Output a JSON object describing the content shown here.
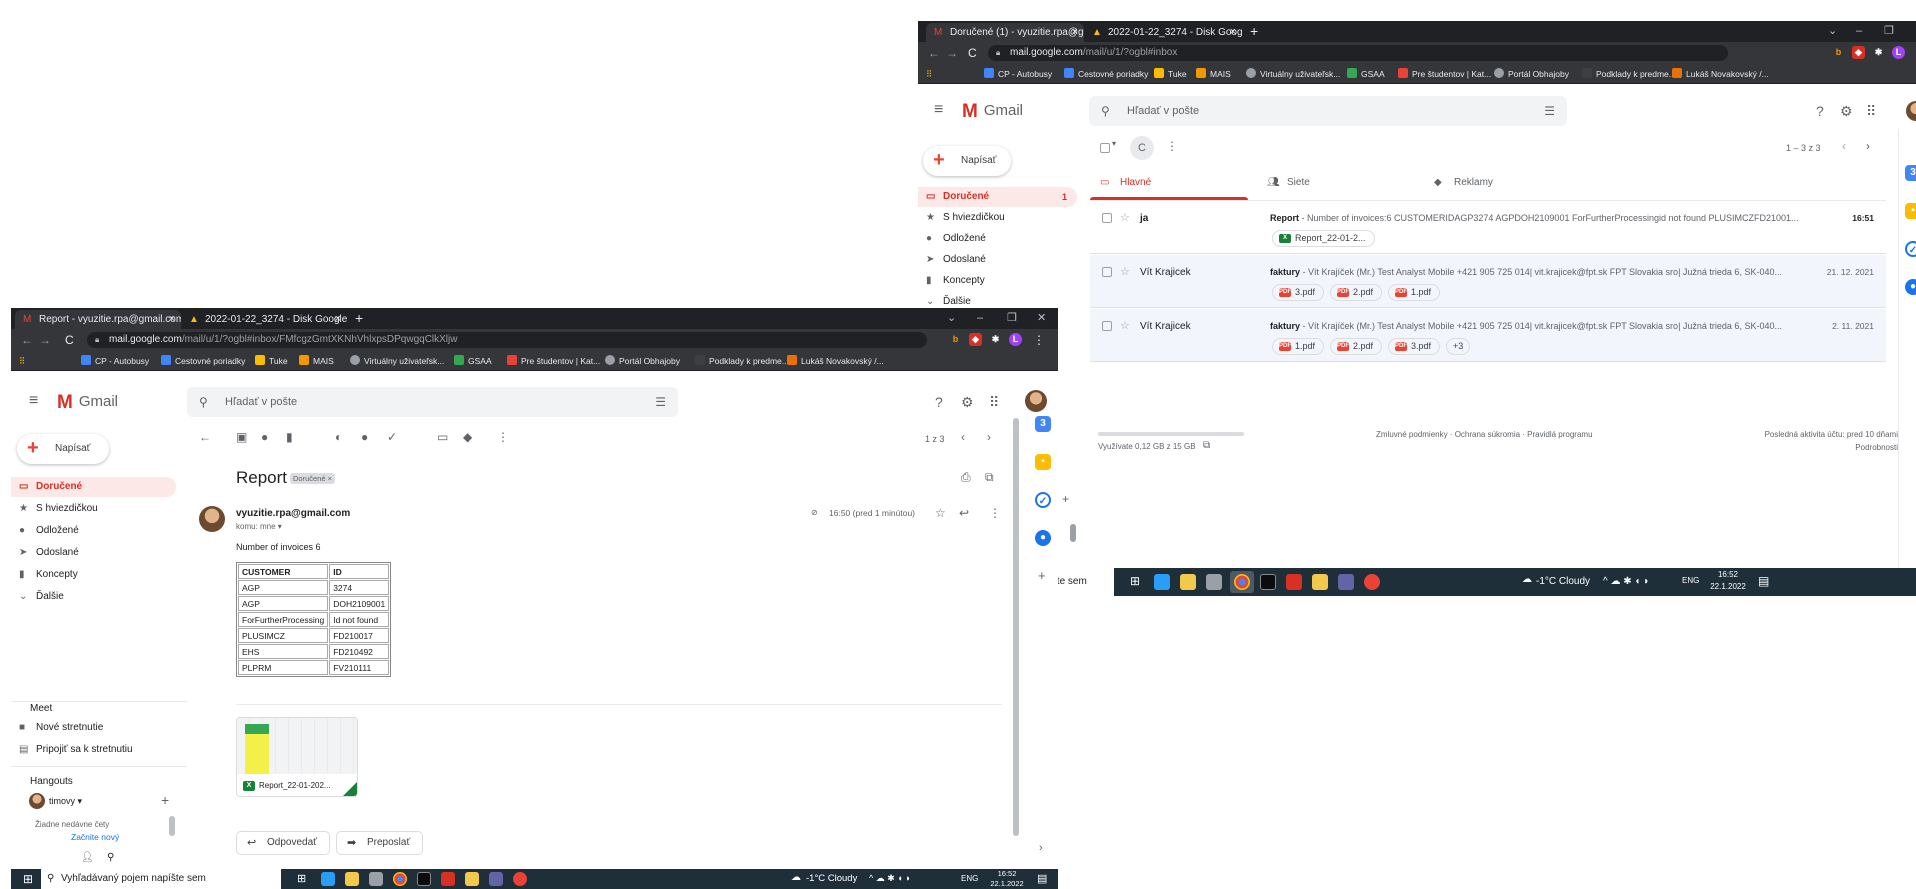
{
  "right_window": {
    "tabs": [
      {
        "title": "Doručené (1) - vyuzitie.rpa@gm...",
        "active": true
      },
      {
        "title": "2022-01-22_3274 - Disk Google",
        "active": false
      }
    ],
    "url": {
      "host": "mail.google.com",
      "path": "/mail/u/1/?ogbl#inbox"
    },
    "search_placeholder": "Hľadať v pošte",
    "compose_label": "Napísať",
    "nav": [
      {
        "label": "Doručené",
        "count": "1",
        "icon": "inbox-icon"
      },
      {
        "label": "S hviezdičkou",
        "icon": "star-icon"
      },
      {
        "label": "Odložené",
        "icon": "clock-icon"
      },
      {
        "label": "Odoslané",
        "icon": "send-icon"
      },
      {
        "label": "Koncepty",
        "icon": "draft-icon"
      },
      {
        "label": "Ďalšie",
        "icon": "chevron-down-icon"
      }
    ],
    "pagination": "1 – 3 z 3",
    "category_tabs": [
      "Hlavné",
      "Siete",
      "Reklamy"
    ],
    "emails": [
      {
        "sender": "ja",
        "subject": "Report",
        "snippet": " - Number of invoices:6 CUSTOMERIDAGP3274 AGPDOH2109001 ForFurtherProcessingid not found PLUSIMCZFD21001...",
        "date": "16:51",
        "attachments": [
          "Report_22-01-2..."
        ]
      },
      {
        "sender": "Vít Krajicek",
        "subject": "faktury",
        "snippet": " - Vít Krajíček (Mr.) Test Analyst Mobile +421 905 725 014| vit.krajicek@fpt.sk FPT Slovakia sro| Južná trieda 6, SK-040...",
        "date": "21. 12. 2021",
        "attachments": [
          "3.pdf",
          "2.pdf",
          "1.pdf"
        ]
      },
      {
        "sender": "Vít Krajicek",
        "subject": "faktury",
        "snippet": " - Vít Krajíček (Mr.) Test Analyst Mobile +421 905 725 014| vit.krajicek@fpt.sk FPT Slovakia sro| Južná trieda 6, SK-040...",
        "date": "2. 11. 2021",
        "attachments": [
          "1.pdf",
          "2.pdf",
          "3.pdf"
        ],
        "more": "+3"
      }
    ],
    "footer": {
      "storage": "Využívate 0,12 GB z 15 GB",
      "links": "Zmluvné podmienky · Ochrana súkromia · Pravidlá programu",
      "activity": "Posledná aktivita účtu: pred 10 dňami",
      "details": "Podrobnosti"
    },
    "taskbar": {
      "search_text": "n napíšte sem",
      "weather": "-1°C  Cloudy",
      "lang": "ENG",
      "time": "16:52",
      "date": "22.1.2022"
    }
  },
  "left_window": {
    "tabs": [
      {
        "title": "Report - vyuzitie.rpa@gmail.com",
        "active": true
      },
      {
        "title": "2022-01-22_3274 - Disk Google",
        "active": false
      }
    ],
    "url": {
      "host": "mail.google.com",
      "path": "/mail/u/1/?ogbl#inbox/FMfcgzGmtXKNhVhlxpsDPqwgqClkXljw"
    },
    "search_placeholder": "Hľadať v pošte",
    "compose_label": "Napísať",
    "nav": [
      {
        "label": "Doručené",
        "icon": "inbox-icon"
      },
      {
        "label": "S hviezdičkou",
        "icon": "star-icon"
      },
      {
        "label": "Odložené",
        "icon": "clock-icon"
      },
      {
        "label": "Odoslané",
        "icon": "send-icon"
      },
      {
        "label": "Koncepty",
        "icon": "draft-icon"
      },
      {
        "label": "Ďalšie",
        "icon": "chevron-down-icon"
      }
    ],
    "meet": {
      "title": "Meet",
      "new_meeting": "Nové stretnutie",
      "join_meeting": "Pripojiť sa k stretnutiu"
    },
    "hangouts": {
      "title": "Hangouts",
      "user": "timovy",
      "no_chats": "Žiadne nedávne čety",
      "start_new": "Začnite nový"
    },
    "pagination": "1 z 3",
    "message": {
      "subject": "Report",
      "label": "Doručené ×",
      "from": "vyuzitie.rpa@gmail.com",
      "to": "komu: mne ▾",
      "time": "16:50 (pred 1 minútou)",
      "body_intro": "Number of invoices 6",
      "table": {
        "headers": [
          "CUSTOMER",
          "ID"
        ],
        "rows": [
          [
            "AGP",
            "3274"
          ],
          [
            "AGP",
            "DOH2109001"
          ],
          [
            "ForFurtherProcessing",
            "Id not found"
          ],
          [
            "PLUSIMCZ",
            "FD210017"
          ],
          [
            "EHS",
            "FD210492"
          ],
          [
            "PLPRM",
            "FV210111"
          ]
        ]
      },
      "attachment_name": "Report_22-01-202...",
      "reply_label": "Odpovedať",
      "forward_label": "Preposlať"
    },
    "taskbar": {
      "search_text": "Vyhľadávaný pojem napíšte sem",
      "weather": "-1°C  Cloudy",
      "lang": "ENG",
      "time": "16:52",
      "date": "22.1.2022"
    }
  },
  "bookmarks": [
    "CP - Autobusy",
    "Cestovné poriadky",
    "Tuke",
    "MAIS",
    "Virtuálny uživateľsk...",
    "GSAA",
    "Pre študentov | Kat...",
    "Portál Obhajoby",
    "Podklady k predme...",
    "Lukáš Novakovský /..."
  ],
  "colors": {
    "gmail_red": "#d93025",
    "chrome_dark": "#202124",
    "chrome_toolbar": "#35363a",
    "taskbar": "#1f2f3a",
    "active_nav_bg": "#fce8e6"
  }
}
